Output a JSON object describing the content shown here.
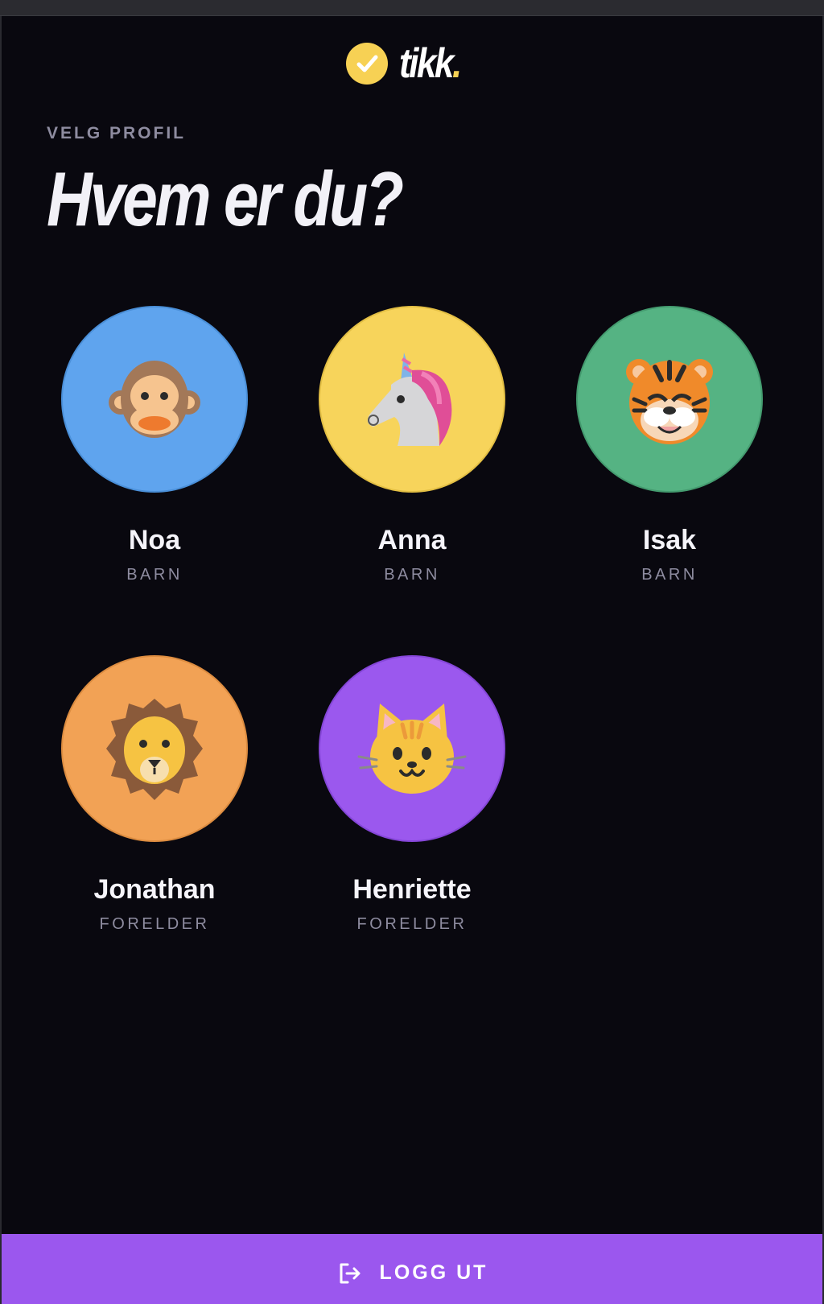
{
  "app": {
    "logo_text": "tikk",
    "logo_dot": "."
  },
  "header": {
    "eyebrow": "VELG PROFIL",
    "title": "Hvem er du?"
  },
  "profiles": [
    {
      "name": "Noa",
      "role": "BARN",
      "avatar": "monkey-icon",
      "color": "#5fa4ee"
    },
    {
      "name": "Anna",
      "role": "BARN",
      "avatar": "unicorn-icon",
      "color": "#f7d45b"
    },
    {
      "name": "Isak",
      "role": "BARN",
      "avatar": "tiger-icon",
      "color": "#55b383"
    },
    {
      "name": "Jonathan",
      "role": "FORELDER",
      "avatar": "lion-icon",
      "color": "#f2a255"
    },
    {
      "name": "Henriette",
      "role": "FORELDER",
      "avatar": "cat-icon",
      "color": "#9b58ee"
    }
  ],
  "footer": {
    "logout_label": "LOGG UT",
    "color": "#9b57ee"
  },
  "colors": {
    "background": "#09080f",
    "accent": "#f7d154"
  }
}
